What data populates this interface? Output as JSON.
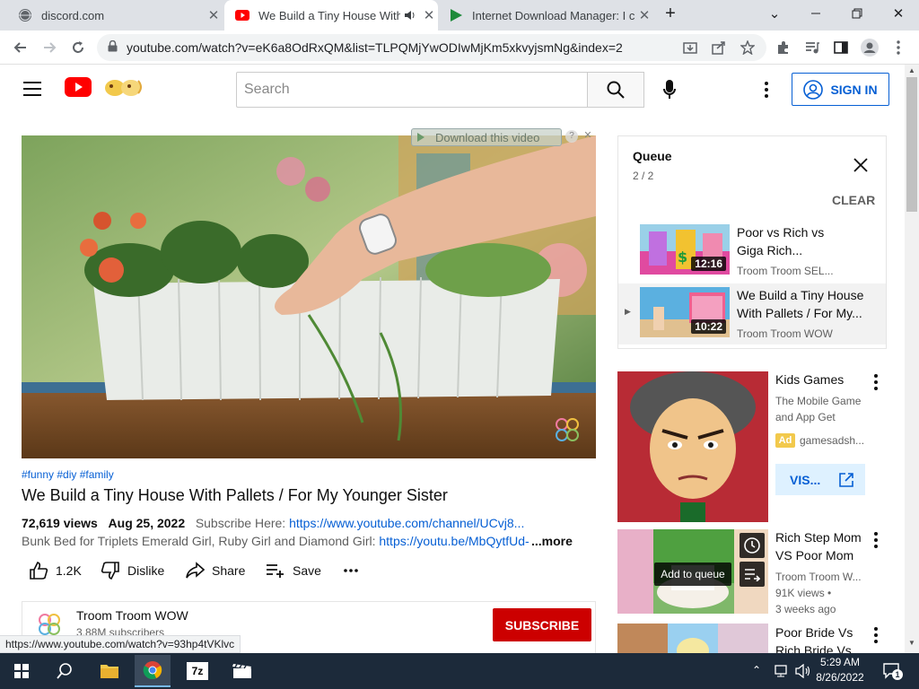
{
  "tabs": [
    {
      "title": "discord.com",
      "close": "✕"
    },
    {
      "title": "We Build a Tiny House With",
      "close": "✕"
    },
    {
      "title": "Internet Download Manager: I ca",
      "close": "✕"
    }
  ],
  "new_tab": "+",
  "window_controls": {
    "minimize": "🗕",
    "restore": "🗗",
    "close": "✕",
    "chevron": "⌄"
  },
  "address_bar": {
    "url": "youtube.com/watch?v=eK6a8OdRxQM&list=TLPQMjYwODIwMjKm5xkvyjsmNg&index=2"
  },
  "youtube": {
    "search_placeholder": "Search",
    "sign_in": "SIGN IN"
  },
  "download_bar": {
    "label": "Download this video",
    "help": "?",
    "close": "✕"
  },
  "video": {
    "hashtags": "#funny #diy #family",
    "title": "We Build a Tiny House With Pallets / For My Younger Sister",
    "views": "72,619 views",
    "date": "Aug 25, 2022",
    "subscribe_prefix": "Subscribe Here:",
    "subscribe_link": "https://www.youtube.com/channel/UCvj8...",
    "desc_prefix": "Bunk Bed for Triplets Emerald Girl, Ruby Girl and Diamond Girl:",
    "desc_link": "https://youtu.be/MbQytfUd-",
    "more": "...more"
  },
  "actions": {
    "like_count": "1.2K",
    "dislike": "Dislike",
    "share": "Share",
    "save": "Save"
  },
  "channel": {
    "name": "Troom Troom WOW",
    "subscribers": "3.88M subscribers",
    "subscribe": "SUBSCRIBE"
  },
  "status_url": "https://www.youtube.com/watch?v=93hp4tVKlvc",
  "queue": {
    "title": "Queue",
    "position": "2 / 2",
    "clear": "CLEAR",
    "items": [
      {
        "title_line1": "Poor vs Rich vs",
        "title_line2": "Giga Rich...",
        "channel": "Troom Troom SEL...",
        "duration": "12:16"
      },
      {
        "title_line1": "We Build a Tiny House",
        "title_line2": "With Pallets / For My...",
        "channel": "Troom Troom WOW",
        "duration": "10:22",
        "current_marker": "▶"
      }
    ]
  },
  "recommendations": [
    {
      "title": "Kids Games",
      "line1": "The Mobile Game",
      "line2": "and App Get",
      "ad": "Ad",
      "ad_source": "gamesadsh...",
      "visit": "VIS..."
    },
    {
      "title_line1": "Rich Step Mom",
      "title_line2": "VS Poor Mom",
      "channel": "Troom Troom W...",
      "views": "91K views •",
      "age": "3 weeks ago",
      "overlay": "Add to queue"
    },
    {
      "title_line1": "Poor Bride Vs",
      "title_line2": "Rich Bride Vs"
    }
  ],
  "taskbar": {
    "time": "5:29 AM",
    "date": "8/26/2022",
    "notifications": "1",
    "app_7z": "7z"
  },
  "colors": {
    "yt_red": "#ff0000",
    "link_blue": "#065fd4",
    "subscribe_red": "#cc0000",
    "taskbar": "#1c2a3a"
  }
}
